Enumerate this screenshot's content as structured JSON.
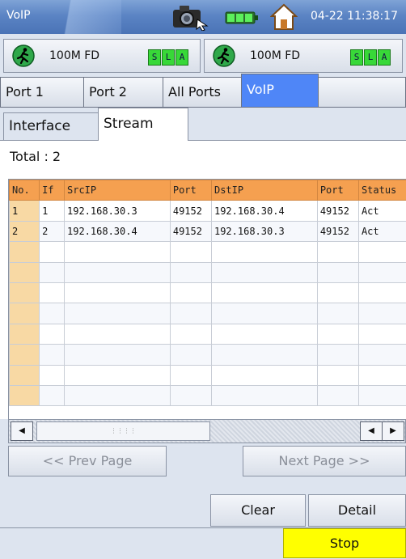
{
  "header": {
    "title": "VoIP",
    "datetime": "04-22 11:38:17",
    "icons": [
      "camera-icon",
      "battery-icon",
      "home-icon"
    ]
  },
  "links": [
    {
      "speed": "100M FD",
      "sla": [
        "S",
        "L",
        "A"
      ]
    },
    {
      "speed": "100M FD",
      "sla": [
        "S",
        "L",
        "A"
      ]
    }
  ],
  "port_tabs": [
    "Port 1",
    "Port 2",
    "All Ports",
    "VoIP"
  ],
  "active_port_tab": "VoIP",
  "sub_tabs": [
    "Interface",
    "Stream"
  ],
  "active_sub_tab": "Stream",
  "summary": {
    "total_label": "Total : 2"
  },
  "table": {
    "columns": [
      "No.",
      "If",
      "SrcIP",
      "Port",
      "DstIP",
      "Port",
      "Status"
    ],
    "rows": [
      [
        "1",
        "1",
        "192.168.30.3",
        "49152",
        "192.168.30.4",
        "49152",
        "Act"
      ],
      [
        "2",
        "2",
        "192.168.30.4",
        "49152",
        "192.168.30.3",
        "49152",
        "Act"
      ]
    ],
    "empty_rows": 8
  },
  "buttons": {
    "prev_page": "<< Prev Page",
    "next_page": "Next Page >>",
    "clear": "Clear",
    "detail": "Detail",
    "stop": "Stop"
  },
  "colors": {
    "header_bg": "#5b84c4",
    "active_tab": "#4f86f7",
    "table_header": "#f5a050",
    "row_header": "#f8d7a0",
    "sla_green": "#38d838",
    "stop_button": "#ffff00"
  }
}
